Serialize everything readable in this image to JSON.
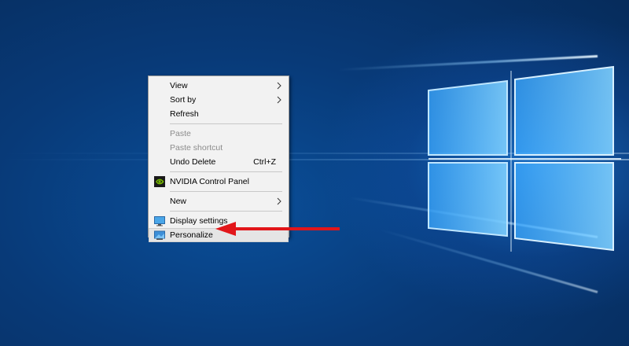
{
  "desktop": {
    "wallpaper": "windows-10-hero"
  },
  "context_menu": {
    "items": [
      {
        "label": "View",
        "submenu": true,
        "disabled": false
      },
      {
        "label": "Sort by",
        "submenu": true,
        "disabled": false
      },
      {
        "label": "Refresh",
        "submenu": false,
        "disabled": false
      },
      {
        "label": "Paste",
        "disabled": true
      },
      {
        "label": "Paste shortcut",
        "disabled": true
      },
      {
        "label": "Undo Delete",
        "shortcut": "Ctrl+Z",
        "disabled": false
      },
      {
        "label": "NVIDIA Control Panel",
        "icon": "nvidia-icon",
        "disabled": false
      },
      {
        "label": "New",
        "submenu": true,
        "disabled": false
      },
      {
        "label": "Display settings",
        "icon": "display-icon",
        "disabled": false
      },
      {
        "label": "Personalize",
        "icon": "personalize-icon",
        "disabled": false,
        "highlighted": true
      }
    ]
  },
  "annotation": {
    "arrow_color": "#e2161a",
    "points_to": "Personalize"
  },
  "colors": {
    "menu_background": "#f2f2f2",
    "disabled_text": "#8c8c8c",
    "highlight": "#e5e5e5",
    "nvidia_green": "#76b900"
  }
}
